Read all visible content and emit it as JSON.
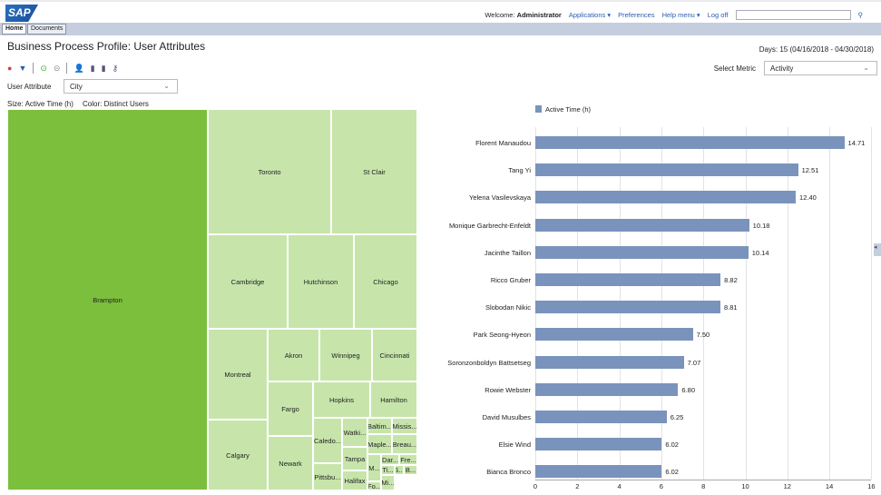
{
  "header": {
    "logo": "SAP",
    "welcome": "Welcome:",
    "user": "Administrator",
    "links": [
      "Applications ▾",
      "Preferences",
      "Help menu ▾",
      "Log off"
    ],
    "search_value": ""
  },
  "tabs": [
    "Home",
    "Documents"
  ],
  "page": {
    "title": "Business Process Profile: User Attributes",
    "days": "Days: 15 (04/16/2018 - 04/30/2018)"
  },
  "controls": {
    "select_metric_label": "Select Metric",
    "select_metric_value": "Activity",
    "user_attribute_label": "User Attribute",
    "user_attribute_value": "City"
  },
  "treemap": {
    "size_label": "Size: Active Time (h)",
    "color_label": "Color: Distinct Users",
    "dark_color": "#7bbf3c",
    "light_color": "#c7e5ab",
    "cells": [
      "Brampton",
      "Toronto",
      "St Clair",
      "Cambridge",
      "Hutchinson",
      "Chicago",
      "Montreal",
      "Calgary",
      "Akron",
      "Winnipeg",
      "Cincinnati",
      "Fargo",
      "Newark",
      "Hopkins",
      "Hamilton",
      "Caledo...",
      "Pittsbu...",
      "Watki...",
      "Tampa",
      "Halifax",
      "Baltim...",
      "Missis...",
      "Maple...",
      "Breau...",
      "M...",
      "Dar...",
      "Fre...",
      "Ti...",
      "S...",
      "B...",
      "Fo...",
      "Mi..."
    ]
  },
  "chart_data": {
    "type": "bar",
    "orientation": "horizontal",
    "legend": "Active Time (h)",
    "legend_position": "top",
    "bar_color": "#7a93bd",
    "xlim": [
      0,
      16
    ],
    "xticks": [
      0,
      2,
      4,
      6,
      8,
      10,
      12,
      14,
      16
    ],
    "grid": true,
    "categories": [
      "Florent Manaudou",
      "Tang Yi",
      "Yelena Vasilevskaya",
      "Monique Garbrecht-Enfeldt",
      "Jacinthe Taillon",
      "Ricco Gruber",
      "Slobodan Nikic",
      "Park Seong-Hyeon",
      "Soronzonboldyn Battsetseg",
      "Rowie Webster",
      "David Musulbes",
      "Elsie Wind",
      "Bianca Bronco"
    ],
    "values": [
      14.71,
      12.51,
      12.4,
      10.18,
      10.14,
      8.82,
      8.81,
      7.5,
      7.07,
      6.8,
      6.25,
      6.02,
      6.02
    ],
    "labels": [
      "14.71",
      "12.51",
      "12.40",
      "10.18",
      "10.14",
      "8.82",
      "8.81",
      "7.50",
      "7.07",
      "6.80",
      "6.25",
      "6.02",
      "6.02"
    ]
  }
}
